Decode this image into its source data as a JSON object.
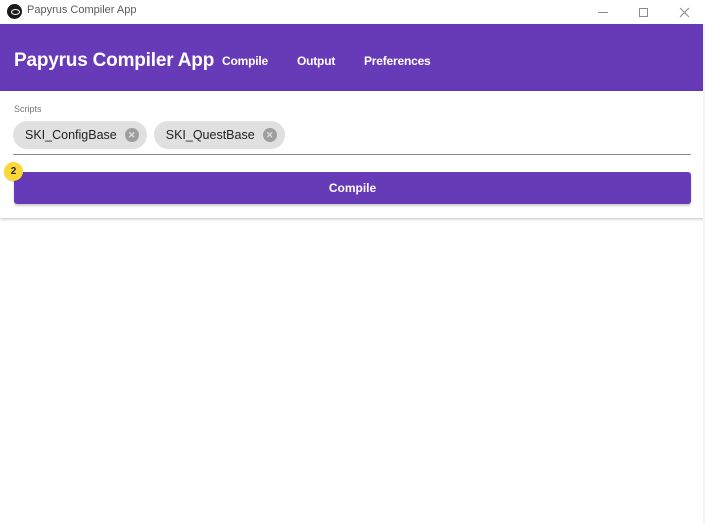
{
  "window": {
    "title": "Papyrus Compiler App",
    "icon": "papyrus-app-icon",
    "controls": {
      "minimize": "minimize-icon",
      "maximize": "maximize-icon",
      "close": "close-icon"
    }
  },
  "appbar": {
    "title": "Papyrus Compiler App",
    "nav": [
      {
        "label": "Compile"
      },
      {
        "label": "Output"
      },
      {
        "label": "Preferences"
      }
    ],
    "color": "#673ab7"
  },
  "form": {
    "scripts_label": "Scripts",
    "chips": [
      {
        "label": "SKI_ConfigBase"
      },
      {
        "label": "SKI_QuestBase"
      }
    ],
    "compile_label": "Compile",
    "badge_count": "2"
  },
  "colors": {
    "primary": "#673ab7",
    "badge": "#fdd835",
    "chip": "#e0e0e0"
  }
}
